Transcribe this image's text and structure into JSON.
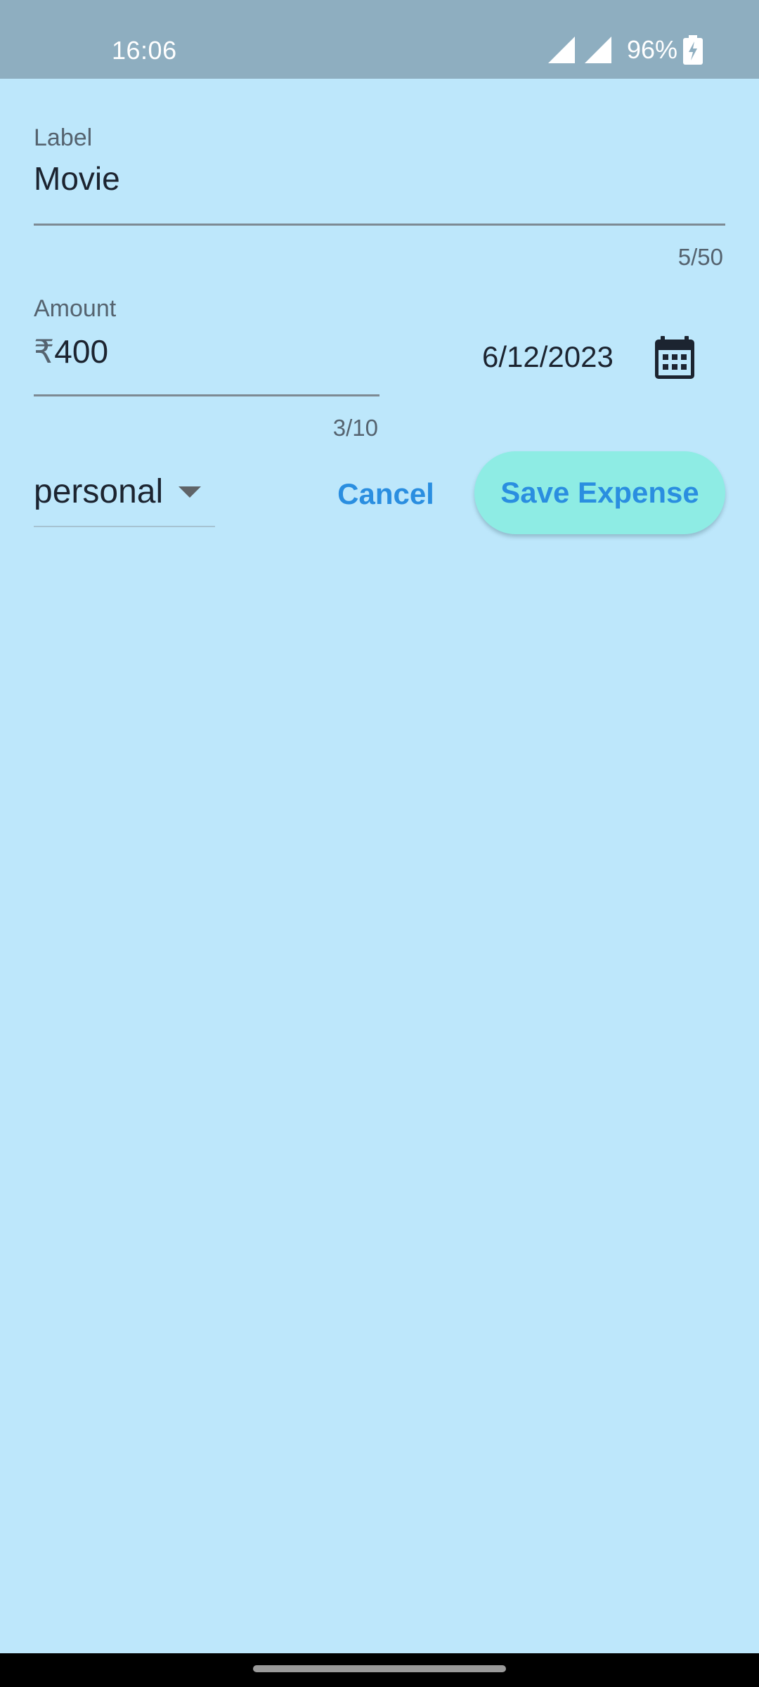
{
  "status_bar": {
    "time": "16:06",
    "battery_percent": "96%",
    "icons": [
      "signal-icon",
      "signal-icon",
      "battery-charging-icon"
    ]
  },
  "form": {
    "label_field": {
      "label": "Label",
      "value": "Movie",
      "counter": "5/50"
    },
    "amount_field": {
      "label": "Amount",
      "prefix": "₹",
      "value": "400",
      "counter": "3/10"
    },
    "date": {
      "value": "6/12/2023",
      "icon": "calendar-icon"
    },
    "category": {
      "selected": "personal",
      "icon": "dropdown-caret-icon"
    }
  },
  "actions": {
    "cancel_label": "Cancel",
    "save_label": "Save Expense"
  },
  "colors": {
    "background": "#bde7fb",
    "status_bar": "#8eaec0",
    "accent": "#2a8ee0",
    "save_button_bg": "#8eece4"
  }
}
